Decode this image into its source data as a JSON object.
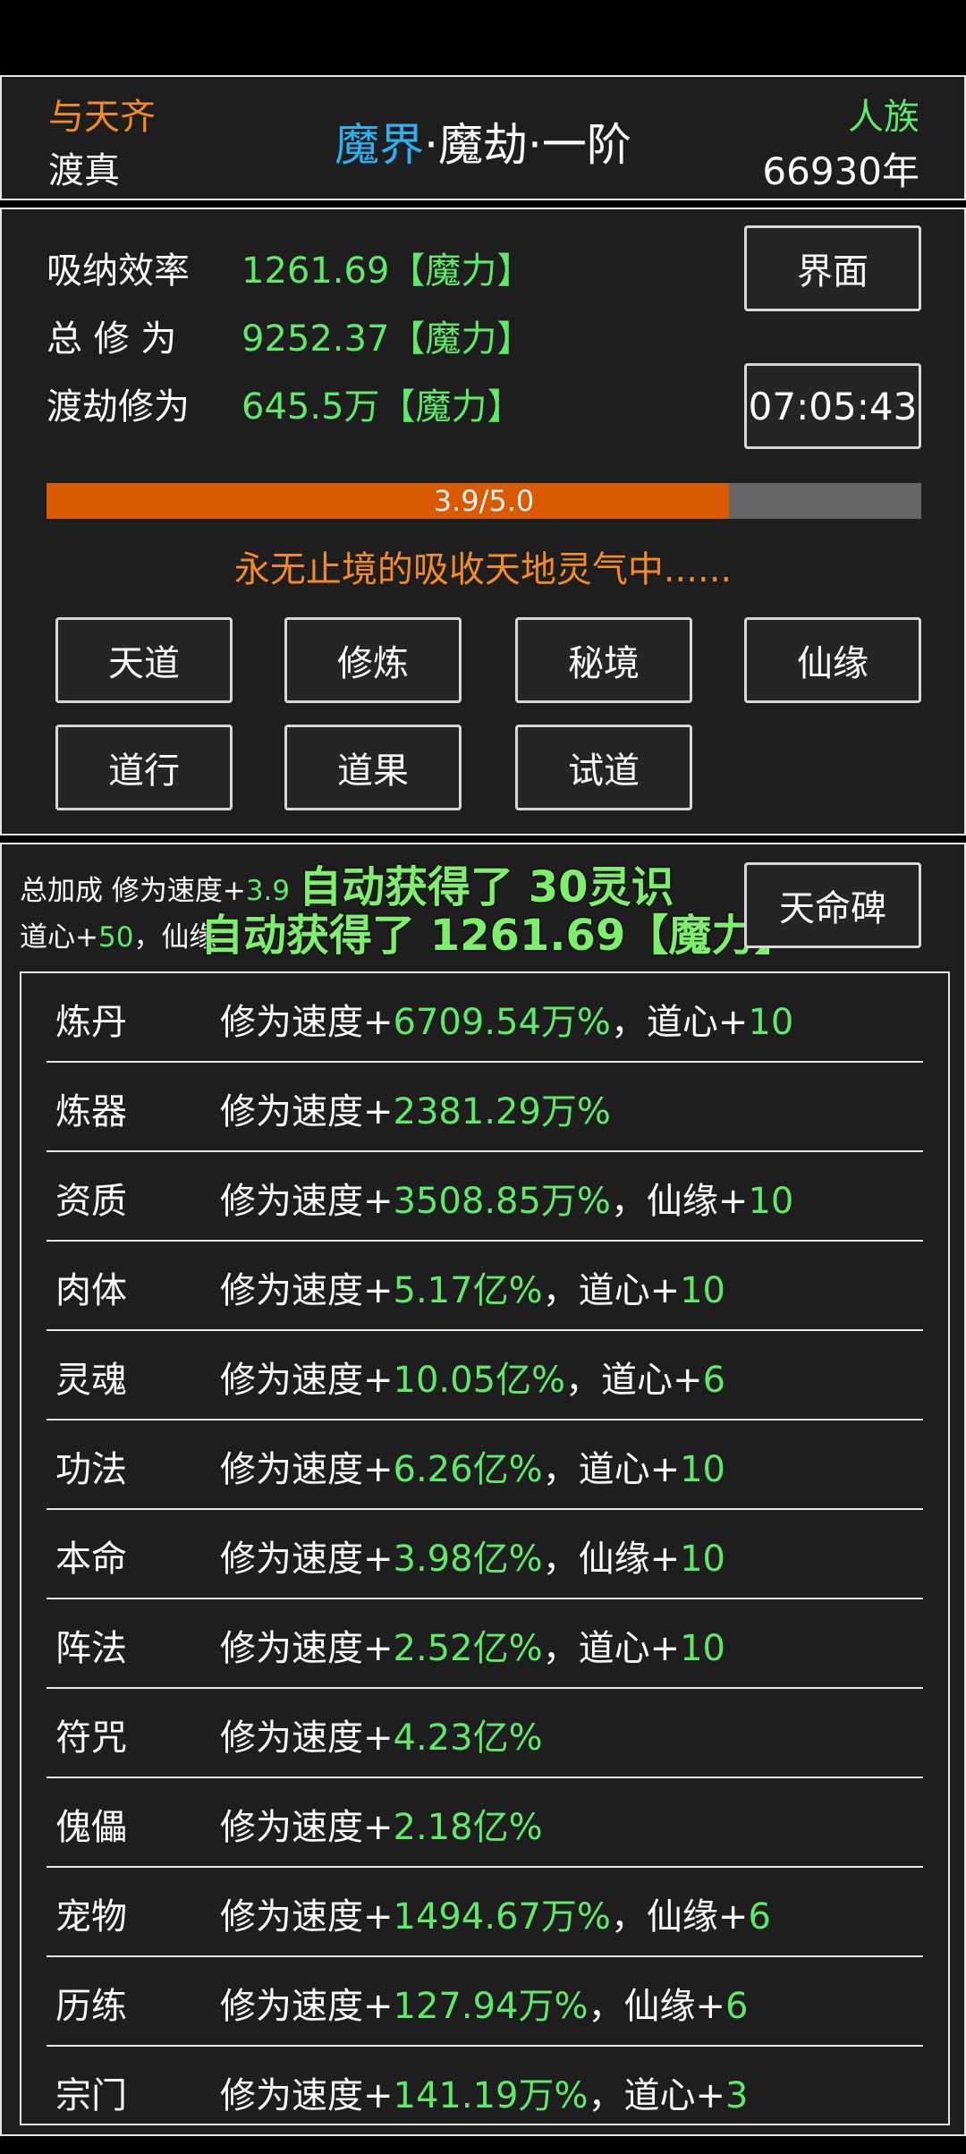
{
  "header": {
    "title_left": "与天齐",
    "sub_left": "渡真",
    "realm_colored": "魔界",
    "realm_rest": "·魔劫·一阶",
    "title_right": "人族",
    "sub_right": "66930年"
  },
  "stats": {
    "rows": [
      {
        "label": "吸纳效率",
        "value": "1261.69【魔力】"
      },
      {
        "label": "总 修 为",
        "value": "9252.37【魔力】"
      },
      {
        "label": "渡劫修为",
        "value": "645.5万【魔力】"
      }
    ],
    "interface_button": "界面",
    "timer": "07:05:43",
    "progress": {
      "text": "3.9/5.0",
      "current": 3.9,
      "max": 5.0
    },
    "status_text": "永无止境的吸收天地灵气中......",
    "menu": [
      "天道",
      "修炼",
      "秘境",
      "仙缘",
      "道行",
      "道果",
      "试道"
    ]
  },
  "bonus": {
    "line1_label": "总加成 修为速度+",
    "line1_value": "3.9",
    "line2_label": "道心+",
    "line2_value": "50",
    "line2_rest": "，仙缘",
    "toast1": "自动获得了 30灵识",
    "toast2": "自动获得了 1261.69【魔力】",
    "fate_button": "天命碑",
    "rows": [
      {
        "cat": "炼丹",
        "prefix": "修为速度+",
        "val": "6709.54万%",
        "extra_label": "，道心+",
        "extra_val": "10"
      },
      {
        "cat": "炼器",
        "prefix": "修为速度+",
        "val": "2381.29万%",
        "extra_label": "",
        "extra_val": ""
      },
      {
        "cat": "资质",
        "prefix": "修为速度+",
        "val": "3508.85万%",
        "extra_label": "，仙缘+",
        "extra_val": "10"
      },
      {
        "cat": "肉体",
        "prefix": "修为速度+",
        "val": "5.17亿%",
        "extra_label": "，道心+",
        "extra_val": "10"
      },
      {
        "cat": "灵魂",
        "prefix": "修为速度+",
        "val": "10.05亿%",
        "extra_label": "，道心+",
        "extra_val": "6"
      },
      {
        "cat": "功法",
        "prefix": "修为速度+",
        "val": "6.26亿%",
        "extra_label": "，道心+",
        "extra_val": "10"
      },
      {
        "cat": "本命",
        "prefix": "修为速度+",
        "val": "3.98亿%",
        "extra_label": "，仙缘+",
        "extra_val": "10"
      },
      {
        "cat": "阵法",
        "prefix": "修为速度+",
        "val": "2.52亿%",
        "extra_label": "，道心+",
        "extra_val": "10"
      },
      {
        "cat": "符咒",
        "prefix": "修为速度+",
        "val": "4.23亿%",
        "extra_label": "",
        "extra_val": ""
      },
      {
        "cat": "傀儡",
        "prefix": "修为速度+",
        "val": "2.18亿%",
        "extra_label": "",
        "extra_val": ""
      },
      {
        "cat": "宠物",
        "prefix": "修为速度+",
        "val": "1494.67万%",
        "extra_label": "，仙缘+",
        "extra_val": "6"
      },
      {
        "cat": "历练",
        "prefix": "修为速度+",
        "val": "127.94万%",
        "extra_label": "，仙缘+",
        "extra_val": "6"
      },
      {
        "cat": "宗门",
        "prefix": "修为速度+",
        "val": "141.19万%",
        "extra_label": "，道心+",
        "extra_val": "3"
      }
    ]
  }
}
